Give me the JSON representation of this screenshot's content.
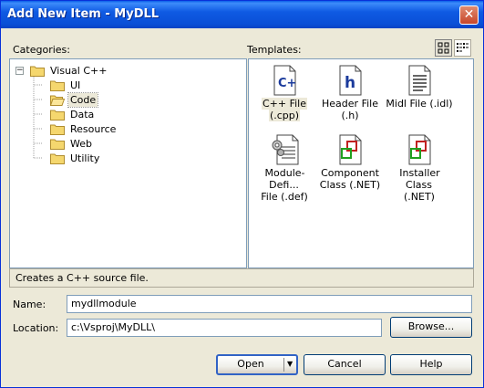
{
  "window": {
    "title": "Add New Item - MyDLL",
    "close_glyph": "✕"
  },
  "categories": {
    "label": "Categories:",
    "tree": [
      {
        "label": "Visual C++",
        "expanded": true,
        "toggle": "−"
      },
      {
        "label": "UI"
      },
      {
        "label": "Code",
        "selected": true
      },
      {
        "label": "Data"
      },
      {
        "label": "Resource"
      },
      {
        "label": "Web"
      },
      {
        "label": "Utility"
      }
    ]
  },
  "templates": {
    "label": "Templates:",
    "view_buttons": [
      "large-icons-view-icon",
      "list-view-icon"
    ],
    "items": [
      {
        "line1": "C++ File",
        "line2": "(.cpp)",
        "icon": "cpp-file-icon",
        "glyph": "C+",
        "selected": true
      },
      {
        "line1": "Header File",
        "line2": "(.h)",
        "icon": "header-file-icon",
        "glyph": "h"
      },
      {
        "line1": "Midl File (.idl)",
        "line2": "",
        "icon": "midl-file-icon"
      },
      {
        "line1": "Module-Defi...",
        "line2": "File (.def)",
        "icon": "module-definition-file-icon"
      },
      {
        "line1": "Component",
        "line2": "Class (.NET)",
        "icon": "component-class-icon"
      },
      {
        "line1": "Installer Class",
        "line2": "(.NET)",
        "icon": "installer-class-icon"
      }
    ]
  },
  "status_text": "Creates a C++ source file.",
  "name_field": {
    "label": "Name:",
    "value": "mydllmodule"
  },
  "location_field": {
    "label": "Location:",
    "value": "c:\\Vsproj\\MyDLL\\"
  },
  "buttons": {
    "browse": "Browse...",
    "open": "Open",
    "cancel": "Cancel",
    "help": "Help"
  },
  "colors": {
    "title_blue": "#0a4fd6",
    "dialog_bg": "#ece9d8",
    "folder_yellow": "#f5d76e"
  }
}
